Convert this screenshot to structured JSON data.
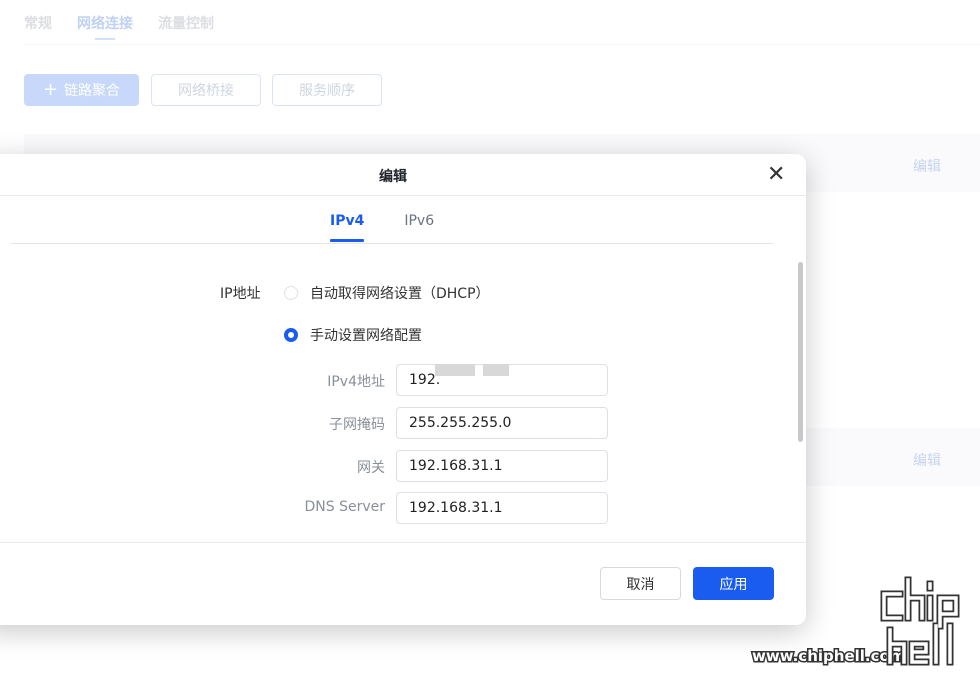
{
  "background": {
    "tabs": [
      {
        "label": "常规",
        "active": false
      },
      {
        "label": "网络连接",
        "active": true
      },
      {
        "label": "流量控制",
        "active": false
      }
    ],
    "toolbar": {
      "add_label": "链路聚合",
      "bridge_label": "网络桥接",
      "order_label": "服务顺序"
    },
    "row_edit_label": "编辑"
  },
  "modal": {
    "title": "编辑",
    "tabs": [
      {
        "label": "IPv4",
        "active": true
      },
      {
        "label": "IPv6",
        "active": false
      }
    ],
    "ip_label": "IP地址",
    "dhcp_option": "自动取得网络设置（DHCP）",
    "manual_option": "手动设置网络配置",
    "fields": [
      {
        "label": "IPv4地址",
        "value": "192."
      },
      {
        "label": "子网掩码",
        "value": "255.255.255.0"
      },
      {
        "label": "网关",
        "value": "192.168.31.1"
      },
      {
        "label": "DNS Server",
        "value": "192.168.31.1"
      }
    ],
    "cancel_label": "取消",
    "apply_label": "应用"
  },
  "watermark": {
    "site": "www.chiphell.com"
  },
  "colors": {
    "accent": "#1a5cf0"
  }
}
